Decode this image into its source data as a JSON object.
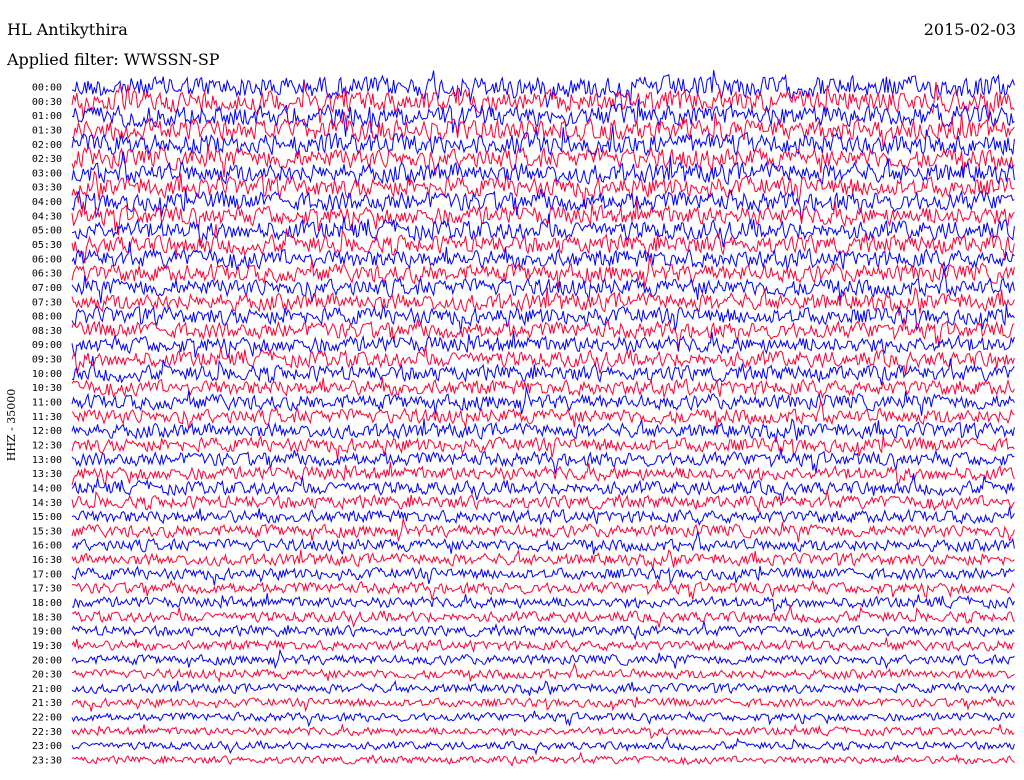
{
  "header": {
    "station": "HL Antikythira",
    "date": "2015-02-03",
    "filter_label": "Applied filter:",
    "filter_value": "WWSSN-SP"
  },
  "chart_data": {
    "type": "line",
    "title": "HL Antikythira",
    "ylabel": "HHZ - 35000",
    "xlabel": "",
    "categories": [
      "00:00",
      "00:30",
      "01:00",
      "01:30",
      "02:00",
      "02:30",
      "03:00",
      "03:30",
      "04:00",
      "04:30",
      "05:00",
      "05:30",
      "06:00",
      "06:30",
      "07:00",
      "07:30",
      "08:00",
      "08:30",
      "09:00",
      "09:30",
      "10:00",
      "10:30",
      "11:00",
      "11:30",
      "12:00",
      "12:30",
      "13:00",
      "13:30",
      "14:00",
      "14:30",
      "15:00",
      "15:30",
      "16:00",
      "16:30",
      "17:00",
      "17:30",
      "18:00",
      "18:30",
      "19:00",
      "19:30",
      "20:00",
      "20:30",
      "21:00",
      "21:30",
      "22:00",
      "22:30",
      "23:00",
      "23:30"
    ],
    "series_colors": [
      "#0000ff",
      "#ff0033"
    ],
    "amplitude_trend": "amplitude decreases from the first hours of the day toward the end",
    "grid": false,
    "legend": "none"
  }
}
